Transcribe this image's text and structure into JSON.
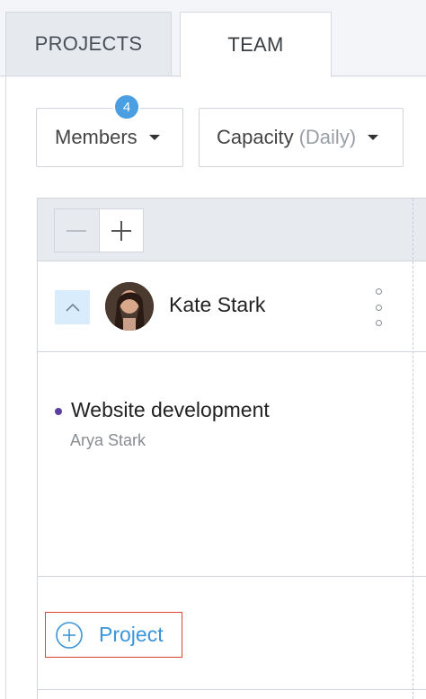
{
  "tabs": [
    {
      "label": "PROJECTS",
      "active": false
    },
    {
      "label": "TEAM",
      "active": true
    }
  ],
  "filters": {
    "members": {
      "label": "Members",
      "badge_count": "4"
    },
    "capacity": {
      "label": "Capacity",
      "mode": "(Daily)"
    }
  },
  "member": {
    "name": "Kate Stark",
    "projects": [
      {
        "title": "Website development",
        "subtitle": "Arya Stark",
        "color": "#5b3fa0"
      }
    ]
  },
  "actions": {
    "add_project_label": "Project"
  },
  "colors": {
    "accent": "#4a9fe2",
    "link": "#3b95d9",
    "highlight_border": "#e0452d",
    "header_bg": "#e7ebf0"
  },
  "icons": {
    "stepper_minus": "minus-icon",
    "stepper_plus": "plus-icon",
    "collapse": "chevron-up-icon",
    "more": "more-vertical-icon",
    "add": "add-circle-icon"
  }
}
